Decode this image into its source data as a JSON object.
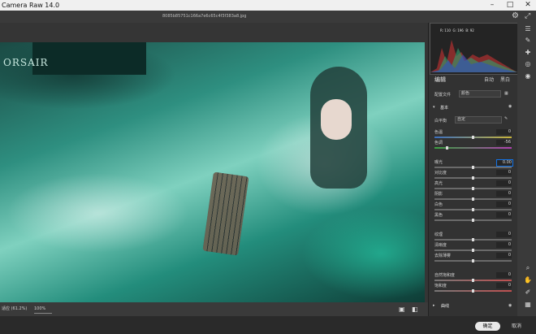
{
  "app": {
    "title": "Camera Raw 14.0"
  },
  "file": {
    "name": "8085b85751c166a7e6c65c4f3f383a8.jpg"
  },
  "toolbar": {
    "settings_icon": "gear-icon",
    "fullscreen_icon": "expand-icon"
  },
  "photo": {
    "brand_text": "ORSAIR"
  },
  "status": {
    "zoom_label": "适应 (61.2%)",
    "zoom_value": "100%"
  },
  "histogram": {
    "r": "R: 110",
    "g": "G: 196",
    "b": "B: 92"
  },
  "edit": {
    "title": "编辑",
    "auto": "自动",
    "bw": "黑白",
    "profile_label": "配置文件",
    "profile_value": "颜色",
    "basic_section": "基本"
  },
  "basic": {
    "wb_label": "白平衡",
    "wb_value": "自定",
    "sliders": [
      {
        "label": "色温",
        "value": "0",
        "pos": 0.5
      },
      {
        "label": "色调",
        "value": "-56",
        "pos": 0.15
      },
      {
        "label": "曝光",
        "value": "0.00",
        "pos": 0.5,
        "highlight": true
      },
      {
        "label": "对比度",
        "value": "0",
        "pos": 0.5
      },
      {
        "label": "高光",
        "value": "0",
        "pos": 0.5
      },
      {
        "label": "阴影",
        "value": "0",
        "pos": 0.5
      },
      {
        "label": "白色",
        "value": "0",
        "pos": 0.5
      },
      {
        "label": "黑色",
        "value": "0",
        "pos": 0.5
      },
      {
        "label": "纹理",
        "value": "0",
        "pos": 0.5
      },
      {
        "label": "清晰度",
        "value": "0",
        "pos": 0.5
      },
      {
        "label": "去除薄雾",
        "value": "0",
        "pos": 0.5
      },
      {
        "label": "自然饱和度",
        "value": "0",
        "pos": 0.5
      },
      {
        "label": "饱和度",
        "value": "0",
        "pos": 0.5
      }
    ]
  },
  "curve": {
    "section": "曲线"
  },
  "buttons": {
    "ok": "确定",
    "cancel": "取消"
  },
  "colors": {
    "accent": "#1473e6",
    "panel": "#323232"
  }
}
